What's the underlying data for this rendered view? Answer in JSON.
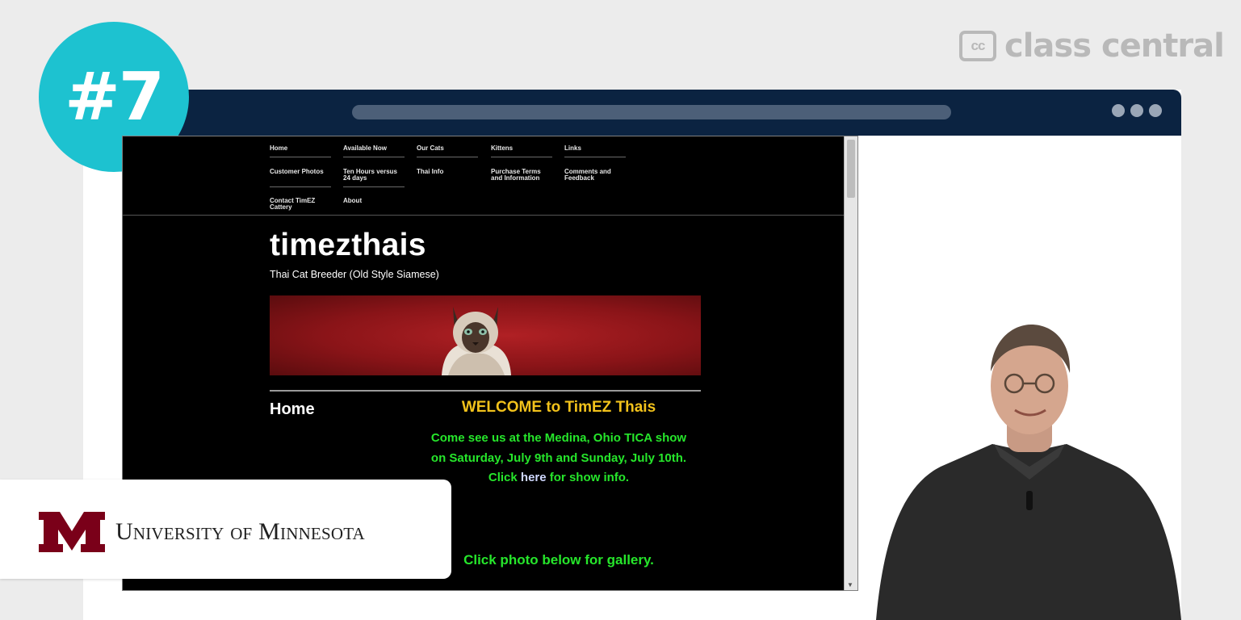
{
  "brand": {
    "logo_mark": "cc",
    "logo_text": "class central",
    "colors": {
      "badge": "#1dc2d0",
      "titlebar": "#0b2341",
      "logo": "#b9b9b9"
    }
  },
  "badge": {
    "label": "#7"
  },
  "site": {
    "nav": [
      {
        "label": "Home"
      },
      {
        "label": "Available Now"
      },
      {
        "label": "Our Cats"
      },
      {
        "label": "Kittens"
      },
      {
        "label": "Links"
      },
      {
        "label": "Customer Photos"
      },
      {
        "label": "Ten Hours versus 24 days"
      },
      {
        "label": "Thai Info"
      },
      {
        "label": "Purchase Terms and Information"
      },
      {
        "label": "Comments and Feedback"
      },
      {
        "label": "Contact TimEZ Cattery"
      },
      {
        "label": "About"
      }
    ],
    "title": "timezthais",
    "subtitle": "Thai Cat Breeder (Old Style Siamese)",
    "page_heading": "Home",
    "welcome": "WELCOME to TimEZ Thais",
    "show_line_1": "Come see us at the Medina, Ohio  TICA show",
    "show_line_2": "on Saturday, July 9th and Sunday, July 10th.",
    "click_prefix": "Click ",
    "click_link": "here",
    "click_suffix": " for show info.",
    "gallery_text": "Click photo below for gallery.",
    "colors": {
      "welcome": "#f2c21b",
      "info": "#26e62b",
      "banner": "#8a1418"
    }
  },
  "partner": {
    "name": "University of Minnesota",
    "color": "#7a0019"
  }
}
